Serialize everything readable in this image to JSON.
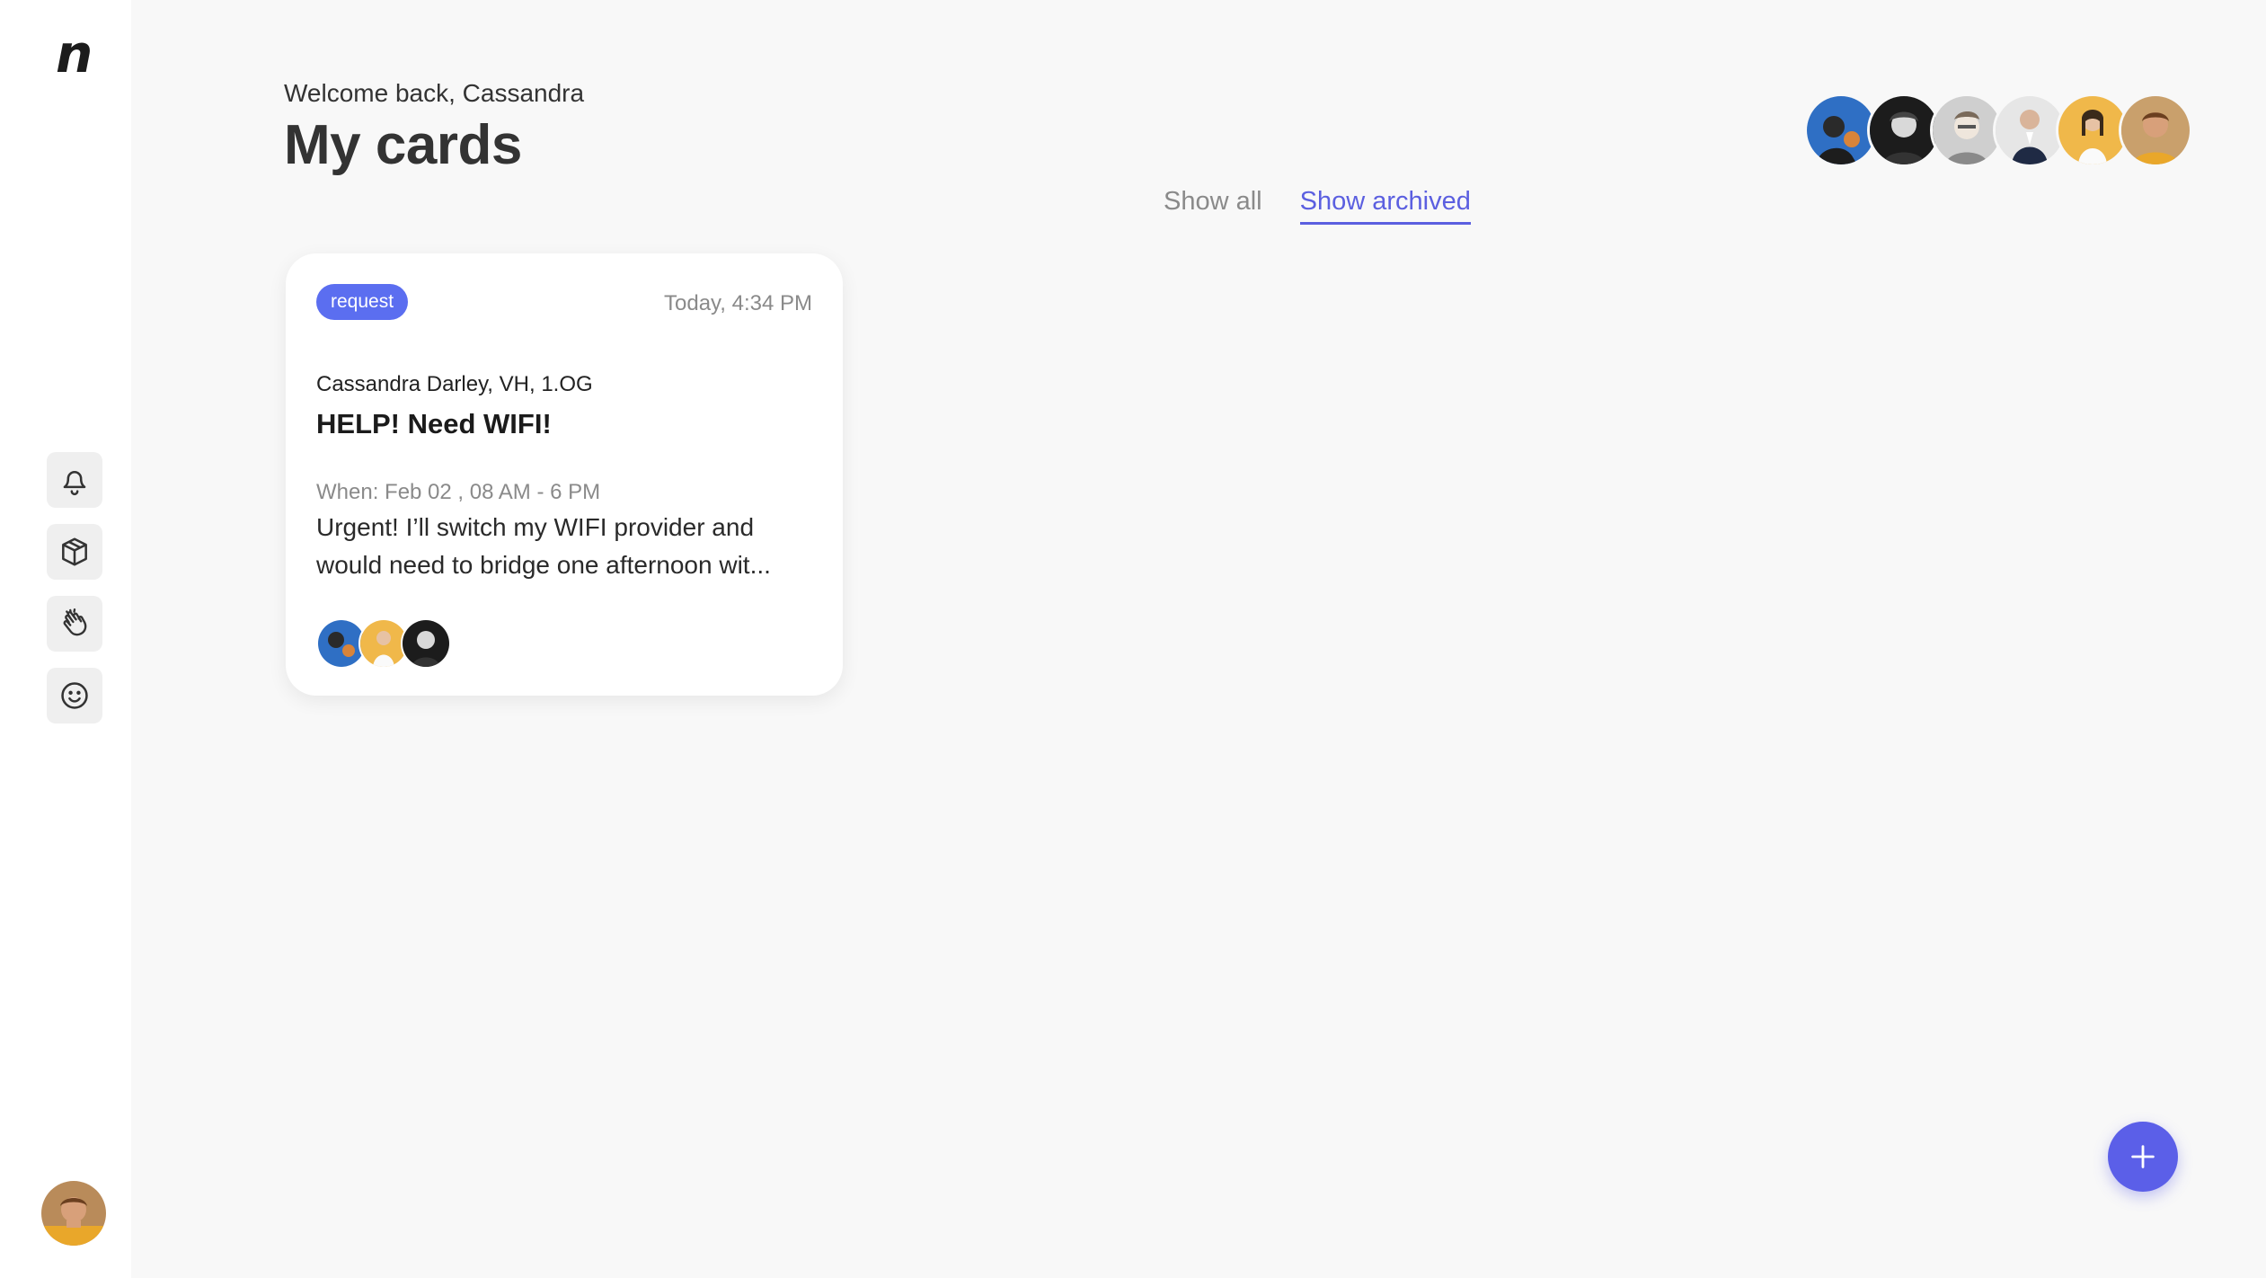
{
  "brand": {
    "logo_text": "n"
  },
  "sidebar": {
    "nav": [
      {
        "icon": "bell-icon"
      },
      {
        "icon": "package-icon"
      },
      {
        "icon": "clap-hands-icon"
      },
      {
        "icon": "smiley-icon"
      }
    ],
    "user_avatar": "user-avatar"
  },
  "header": {
    "welcome": "Welcome back, Cassandra",
    "title": "My cards"
  },
  "filters": {
    "show_all": "Show all",
    "show_archived": "Show archived",
    "active": "show_archived"
  },
  "team": {
    "member_count": 6
  },
  "cards": [
    {
      "tag": "request",
      "time": "Today, 4:34 PM",
      "author": "Cassandra Darley, VH, 1.OG",
      "title": "HELP! Need WIFI!",
      "when": "When: Feb 02 , 08 AM - 6 PM",
      "description": "Urgent! I’ll switch my WIFI provider and would need to bridge one afternoon wit...",
      "participant_count": 3
    }
  ],
  "fab": {
    "icon": "plus-icon"
  },
  "colors": {
    "accent": "#5b5fe0",
    "tag": "#5b6ef0",
    "background": "#f8f8f8"
  }
}
